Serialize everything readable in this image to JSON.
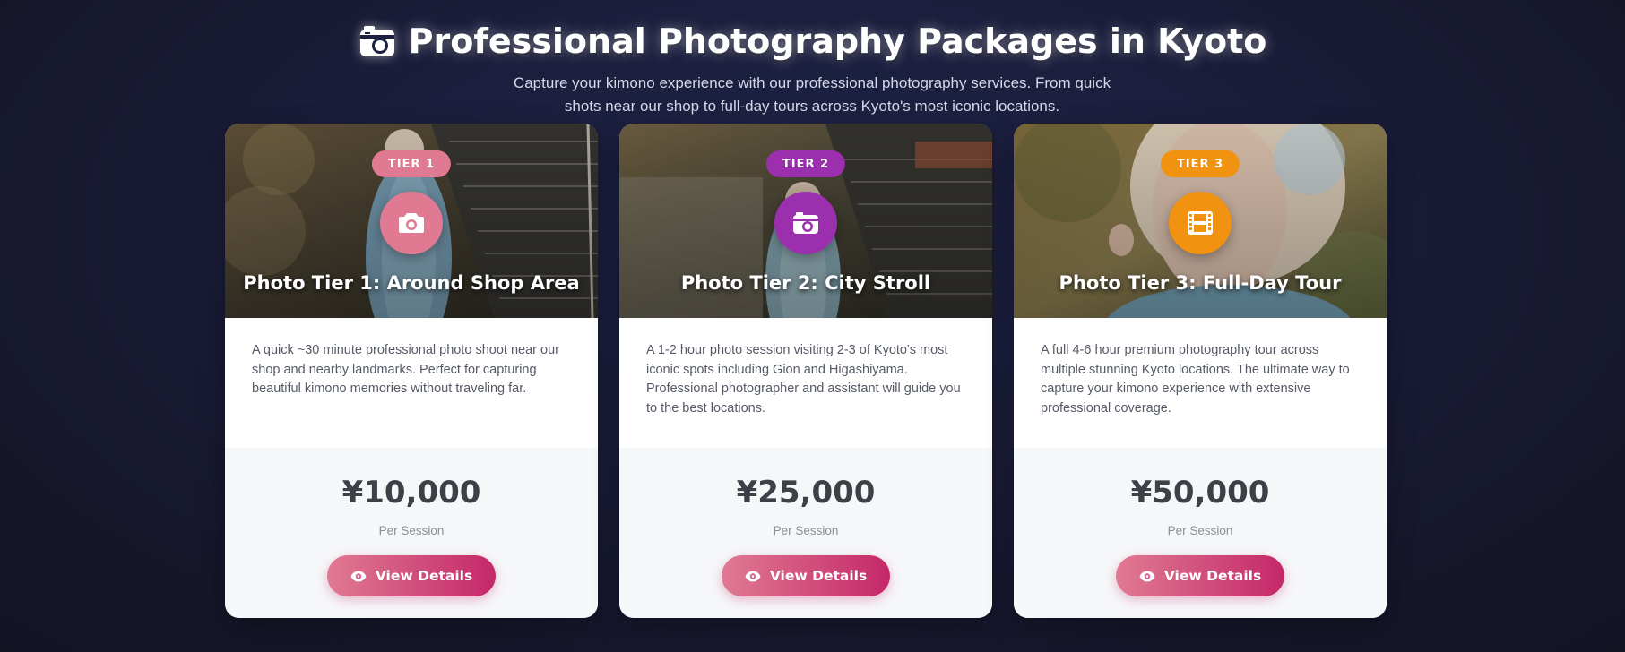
{
  "header": {
    "title": "Professional Photography Packages in Kyoto",
    "title_icon": "camera-retro-icon",
    "subtitle": "Capture your kimono experience with our professional photography services. From quick shots near our shop to full-day tours across Kyoto's most iconic locations."
  },
  "colors": {
    "tier1": "#e07a93",
    "tier2": "#9b2fae",
    "tier3": "#f19310",
    "button_start": "#e07a93",
    "button_end": "#c42868"
  },
  "cards": [
    {
      "badge": "TIER 1",
      "icon": "camera-icon",
      "title": "Photo Tier 1: Around Shop Area",
      "description": "A quick ~30 minute professional photo shoot near our shop and nearby landmarks. Perfect for capturing beautiful kimono memories without traveling far.",
      "price": "¥10,000",
      "per": "Per Session",
      "button": "View Details"
    },
    {
      "badge": "TIER 2",
      "icon": "camera-retro-icon",
      "title": "Photo Tier 2: City Stroll",
      "description": "A 1-2 hour photo session visiting 2-3 of Kyoto's most iconic spots including Gion and Higashiyama. Professional photographer and assistant will guide you to the best locations.",
      "price": "¥25,000",
      "per": "Per Session",
      "button": "View Details"
    },
    {
      "badge": "TIER 3",
      "icon": "film-icon",
      "title": "Photo Tier 3: Full-Day Tour",
      "description": "A full 4-6 hour premium photography tour across multiple stunning Kyoto locations. The ultimate way to capture your kimono experience with extensive professional coverage.",
      "price": "¥50,000",
      "per": "Per Session",
      "button": "View Details"
    }
  ]
}
